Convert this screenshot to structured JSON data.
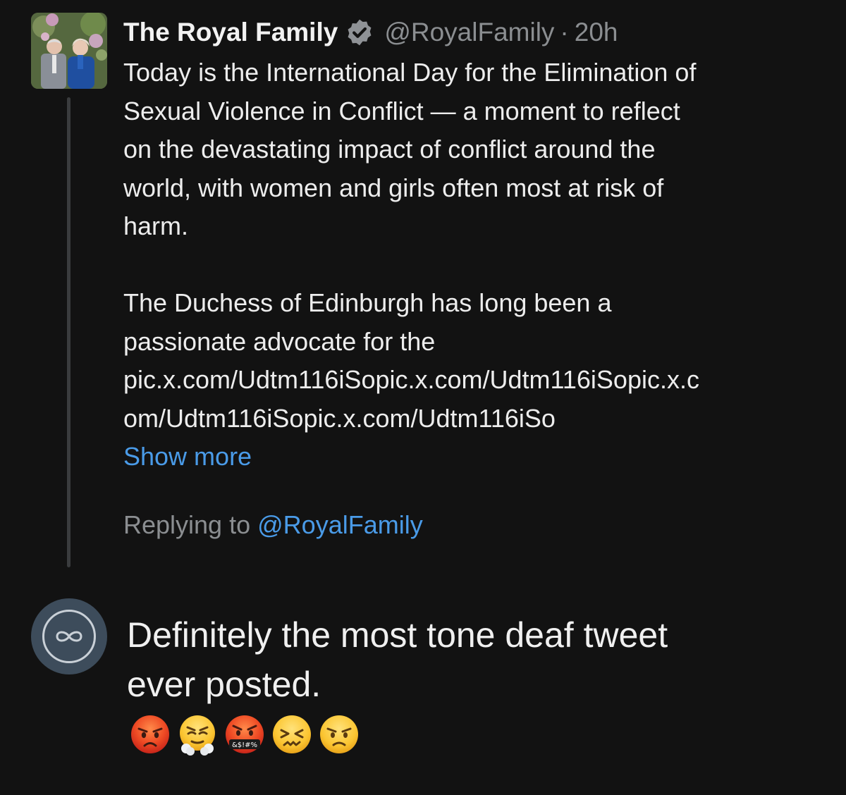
{
  "tweet": {
    "display_name": "The Royal Family",
    "handle": "@RoyalFamily",
    "separator": "·",
    "time": "20h",
    "body_lines": [
      "Today is the International Day for the Elimination of",
      "Sexual Violence in Conflict — a moment to reflect",
      "on the devastating impact of conflict around the",
      "world, with women and girls often most at risk of",
      "harm."
    ],
    "body_lines_2": [
      "The Duchess of Edinburgh has long been a",
      "passionate advocate for the",
      "pic.x.com/Udtm116iSopic.x.com/Udtm116iSopic.x.c",
      "om/Udtm116iSopic.x.com/Udtm116iSo"
    ],
    "show_more_label": "Show more",
    "replying_prefix": "Replying to",
    "replying_mention": "@RoyalFamily"
  },
  "reply": {
    "lines": [
      "Definitely the most tone deaf tweet",
      "ever posted."
    ],
    "avatar_icon": "infinity-icon",
    "emojis": [
      "pouting-face",
      "face-with-steam-from-nose",
      "face-with-symbols-on-mouth",
      "confounded-face",
      "angry-face"
    ],
    "emoji_symbols_text": "&$!#%"
  },
  "colors": {
    "background": "#121212",
    "link": "#4a9be8",
    "muted": "#8b8e91",
    "text": "#ededed",
    "verified_badge": "#8f9296"
  }
}
